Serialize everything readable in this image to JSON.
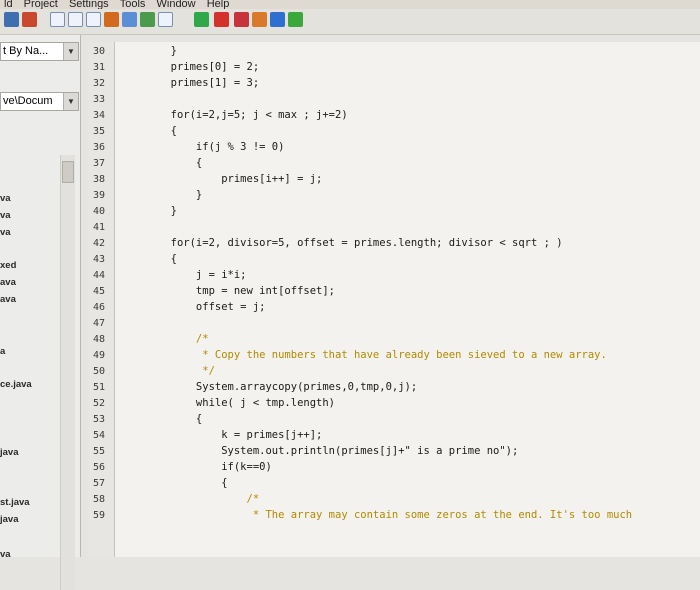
{
  "menu": [
    "ld",
    "Project",
    "Settings",
    "Tools",
    "Window",
    "Help"
  ],
  "sidebar": {
    "dropdown1": "t By Na...",
    "dropdown2": "ve\\Docum",
    "files": [
      "va",
      "va",
      "va",
      "xed",
      "ava",
      "ava",
      "a",
      "ce.java",
      "java",
      "st.java",
      "java",
      "va"
    ]
  },
  "editor": {
    "line_numbers": [
      "30",
      "31",
      "32",
      "33",
      "34",
      "35",
      "36",
      "37",
      "38",
      "39",
      "40",
      "41",
      "42",
      "43",
      "44",
      "45",
      "46",
      "47",
      "48",
      "49",
      "50",
      "51",
      "52",
      "53",
      "54",
      "55",
      "56",
      "57",
      "58",
      "59"
    ],
    "lines": [
      "  }",
      "  primes[0] = 2;",
      "  primes[1] = 3;",
      "",
      "  for(i=2,j=5; j < max ; j+=2)",
      "  {",
      "      if(j % 3 != 0)",
      "      {",
      "          primes[i++] = j;",
      "      }",
      "  }",
      "",
      "  for(i=2, divisor=5, offset = primes.length; divisor < sqrt ; )",
      "  {",
      "      j = i*i;",
      "      tmp = new int[offset];",
      "      offset = j;",
      "",
      "      /*",
      "       * Copy the numbers that have already been sieved to a new array.",
      "       */",
      "      System.arraycopy(primes,0,tmp,0,j);",
      "      while( j < tmp.length)",
      "      {",
      "          k = primes[j++];",
      "          System.out.println(primes[j]+\" is a prime no\");",
      "          if(k==0)",
      "          {",
      "              /*",
      "               * The array may contain some zeros at the end. It's too much"
    ]
  }
}
